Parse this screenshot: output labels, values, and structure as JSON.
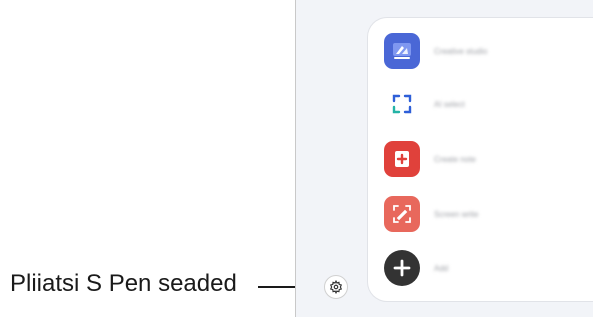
{
  "callout": {
    "label": "Pliiatsi S Pen seaded"
  },
  "menu": {
    "items": [
      {
        "label": "Creative studio",
        "icon": "creative-studio-icon",
        "color": "#4a67d6"
      },
      {
        "label": "AI select",
        "icon": "ai-select-icon",
        "color": "#2e5fd8"
      },
      {
        "label": "Create note",
        "icon": "create-note-icon",
        "color": "#e0413b"
      },
      {
        "label": "Screen write",
        "icon": "screen-write-icon",
        "color": "#e8685c"
      },
      {
        "label": "Add",
        "icon": "add-icon",
        "color": "#333333"
      }
    ]
  }
}
